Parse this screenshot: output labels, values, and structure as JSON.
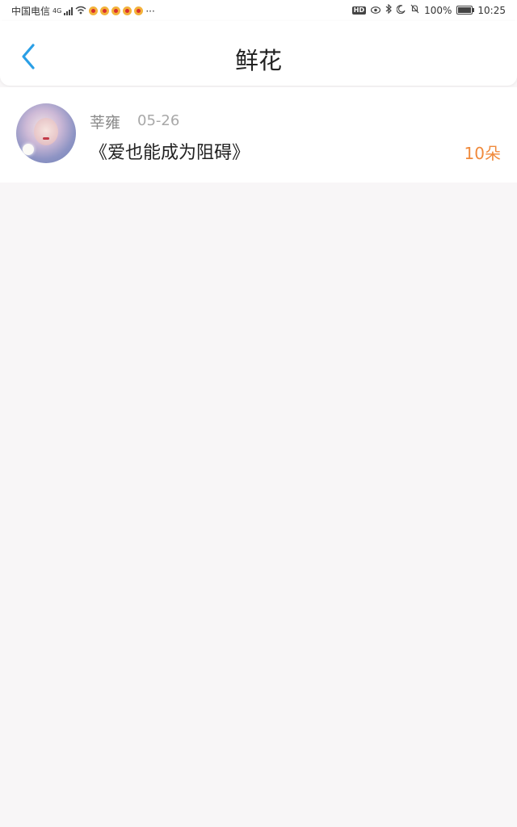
{
  "status_bar": {
    "carrier": "中国电信",
    "network": "4G",
    "more": "···",
    "battery_percent": "100%",
    "time": "10:25",
    "icons": [
      "hd-icon",
      "eye-icon",
      "bluetooth-icon",
      "moon-icon",
      "mute-bell-icon",
      "battery-icon"
    ]
  },
  "header": {
    "back_icon": "chevron-left-icon",
    "title": "鲜花"
  },
  "list": {
    "items": [
      {
        "avatar": "avatar",
        "username": "莘雍",
        "date": "05-26",
        "title": "《爱也能成为阻碍》",
        "count": "10朵"
      }
    ]
  },
  "colors": {
    "accent_blue": "#2a9fe6",
    "count_orange": "#f08a3c",
    "background": "#f8f6f7"
  }
}
